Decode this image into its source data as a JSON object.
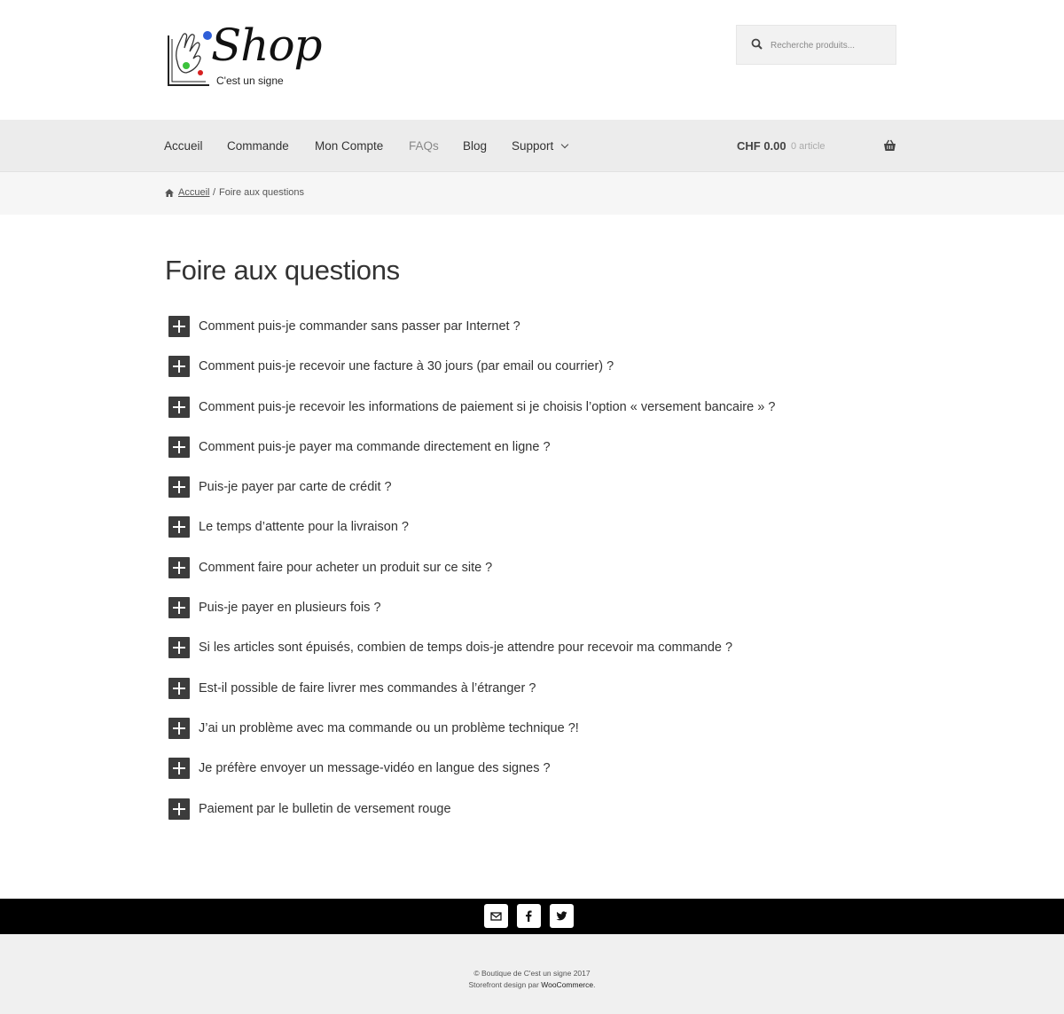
{
  "header": {
    "logo_word": "Shop",
    "logo_tagline": "C'est un signe",
    "search_placeholder": "Recherche produits..."
  },
  "nav": {
    "items": [
      {
        "label": "Accueil"
      },
      {
        "label": "Commande"
      },
      {
        "label": "Mon Compte"
      },
      {
        "label": "FAQs"
      },
      {
        "label": "Blog"
      },
      {
        "label": "Support"
      }
    ],
    "active": "FAQs",
    "cart_amount": "CHF 0.00",
    "cart_count": "0 article"
  },
  "breadcrumb": {
    "home": "Accueil",
    "separator": "/",
    "current": "Foire aux questions"
  },
  "main": {
    "title": "Foire aux questions",
    "faqs": [
      "Comment puis-je commander sans passer par Internet ?",
      "Comment puis-je recevoir une facture à 30 jours (par email ou courrier) ?",
      "Comment puis-je recevoir les informations de paiement si je choisis l’option « versement bancaire » ?",
      "Comment puis-je payer ma commande directement en ligne ?",
      "Puis-je payer par carte de crédit ?",
      "Le temps d’attente pour la livraison ?",
      "Comment faire pour acheter un produit sur ce site ?",
      "Puis-je payer en plusieurs fois ?",
      "Si les articles sont épuisés, combien de temps dois-je attendre pour recevoir ma commande ?",
      "Est-il possible de faire livrer mes commandes à l’étranger ?",
      "J’ai un problème avec ma commande ou un problème technique ?!",
      "Je préfère envoyer un message-vidéo en langue des signes ?",
      "Paiement par le bulletin de versement rouge"
    ]
  },
  "social": {
    "icons": [
      "email-icon",
      "facebook-icon",
      "twitter-icon"
    ]
  },
  "footer": {
    "copyright": "© Boutique de C'est un signe 2017",
    "credit_prefix": "Storefront design par ",
    "credit_link": "WooCommerce",
    "credit_suffix": "."
  },
  "colors": {
    "navbar_bg": "#ececec",
    "breadcrumb_bg": "#f6f6f6",
    "plus_box": "#3c3c3c",
    "social_bar": "#000000",
    "footer_bg": "#f0f0f0",
    "logo_blue": "#2f5fd8",
    "logo_green": "#3cc23c",
    "logo_red": "#d62020"
  }
}
